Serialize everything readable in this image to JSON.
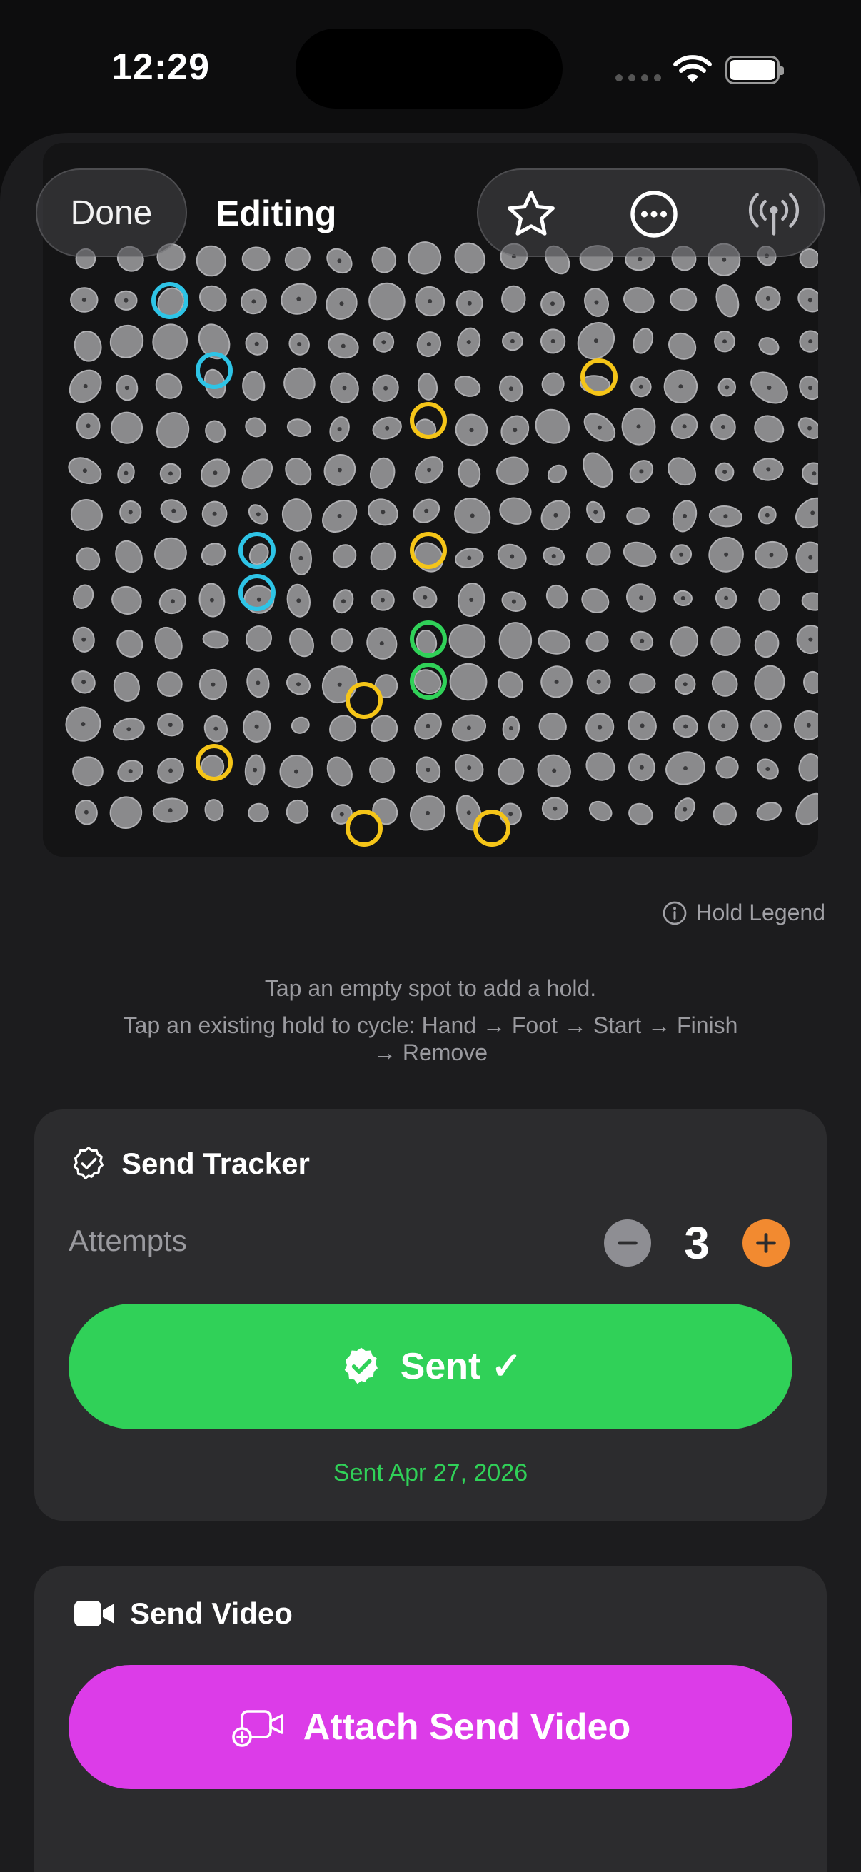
{
  "status": {
    "time": "12:29"
  },
  "nav": {
    "done_label": "Done",
    "title": "Editing"
  },
  "legend": {
    "label": "Hold Legend"
  },
  "hints": {
    "line1": "Tap an empty spot to add a hold.",
    "line2": "Tap an existing hold to cycle:  Hand → Foot → Start → Finish",
    "line3": "→ Remove"
  },
  "send_tracker": {
    "title": "Send Tracker",
    "attempts_label": "Attempts",
    "attempts": "3",
    "sent_label": "Sent ✓",
    "sent_date": "Sent Apr 27, 2026"
  },
  "send_video": {
    "title": "Send Video",
    "attach_label": "Attach Send Video"
  },
  "colors": {
    "hand": "#2ec4e6",
    "foot": "#f5c518",
    "start": "#30d158",
    "sent_green": "#30d158",
    "video_magenta": "#dc3ce8",
    "plus_orange": "#f28a30"
  },
  "board": {
    "marked_holds": [
      {
        "type": "hand"
      },
      {
        "type": "hand"
      },
      {
        "type": "hand"
      },
      {
        "type": "hand"
      },
      {
        "type": "foot"
      },
      {
        "type": "foot"
      },
      {
        "type": "foot"
      },
      {
        "type": "foot"
      },
      {
        "type": "foot"
      },
      {
        "type": "foot"
      },
      {
        "type": "foot"
      },
      {
        "type": "start"
      },
      {
        "type": "start"
      }
    ]
  }
}
